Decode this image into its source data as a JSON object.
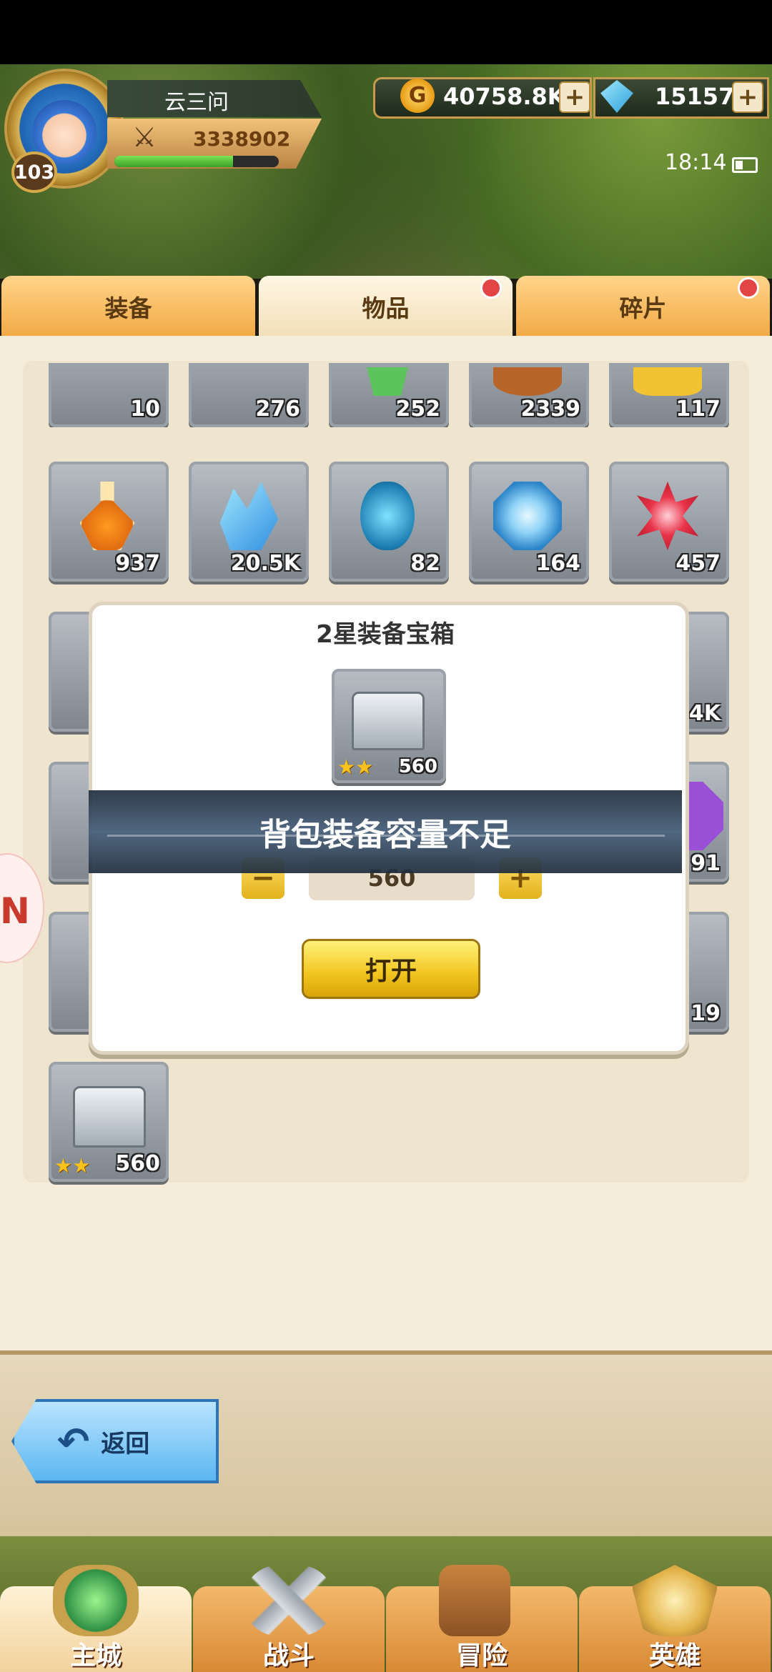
{
  "player": {
    "name": "云三问",
    "level": "103",
    "power": "3338902",
    "xp_fraction": 0.72
  },
  "resources": {
    "gold": "40758.8K",
    "gems": "15157"
  },
  "status": {
    "time": "18:14"
  },
  "tabs": [
    {
      "label": "装备",
      "active": false,
      "badge": false
    },
    {
      "label": "物品",
      "active": true,
      "badge": true
    },
    {
      "label": "碎片",
      "active": false,
      "badge": true
    }
  ],
  "inventory": {
    "row1": [
      "10",
      "276",
      "252",
      "2339",
      "117"
    ],
    "row2": [
      "937",
      "20.5K",
      "82",
      "164",
      "457"
    ],
    "row3_partial_right": "4K",
    "row4_partial_right": "91",
    "row5_partial_right": "19",
    "last_item": {
      "qty": "560",
      "stars": "★★"
    }
  },
  "dialog": {
    "title": "2星装备宝箱",
    "chest_qty": "560",
    "chest_stars": "★★",
    "quantity": "560",
    "minus": "−",
    "plus": "+",
    "open_label": "打开"
  },
  "toast": {
    "message": "背包装备容量不足"
  },
  "back_label": "返回",
  "nav": [
    "主城",
    "战斗",
    "冒险",
    "英雄"
  ],
  "colors": {
    "accent_gold": "#f1c41e",
    "tab_orange": "#f2a944",
    "badge_red": "#e34444"
  }
}
